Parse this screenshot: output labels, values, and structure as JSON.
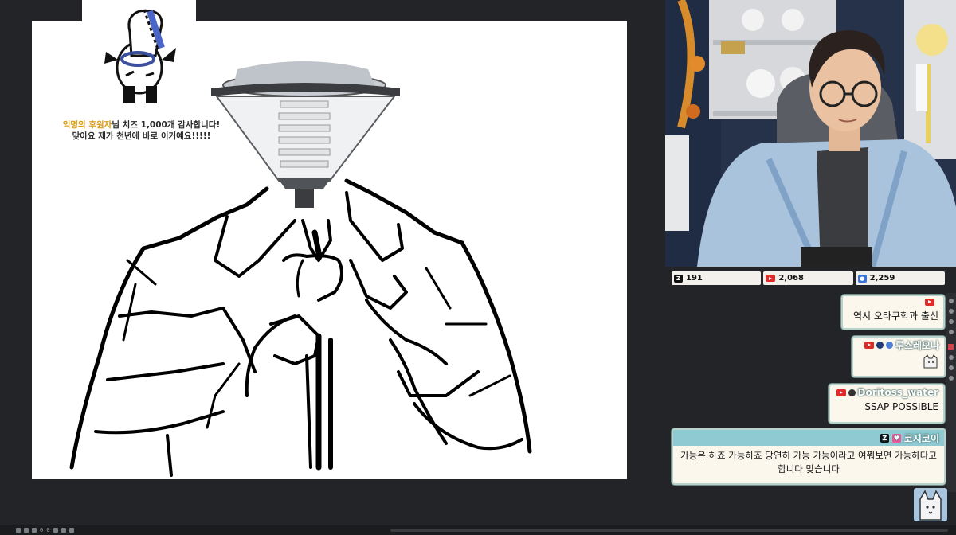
{
  "sticker": {
    "caption_line1_highlight": "익명의 후원자",
    "caption_line1_rest": "님 치즈 1,000개 감사합니다!",
    "caption_line2": "맞아요 제가 천년에 바로 이거예요!!!!!"
  },
  "stats": [
    {
      "icon": "chzzk-icon",
      "color": "#111111",
      "value": "191"
    },
    {
      "icon": "youtube-icon",
      "color": "#e12b2b",
      "value": "2,068"
    },
    {
      "icon": "people-icon",
      "color": "#3b74d8",
      "value": "2,259"
    }
  ],
  "chat": [
    {
      "platform": "youtube",
      "name": "",
      "text": "역시 오타쿠학과 출신"
    },
    {
      "platform": "youtube",
      "name": "루스레오나",
      "text": ""
    },
    {
      "platform": "youtube",
      "name": "Doritoss_water",
      "text": "SSAP POSSIBLE"
    }
  ],
  "highlight_message": {
    "platform": "chzzk",
    "name": "코지코이",
    "text": "가능은 하죠 가능하죠 당연히 가능 가능이라고 여쭤보면 가능하다고 합니다 맞습니다"
  },
  "toolbar": {
    "zoom": "0.0"
  },
  "colors": {
    "background": "#222427",
    "bubble_bg": "#fbf7ec",
    "bubble_border": "#b9d3cc",
    "highlight_header": "#8fcad3",
    "youtube_red": "#e12b2b"
  }
}
